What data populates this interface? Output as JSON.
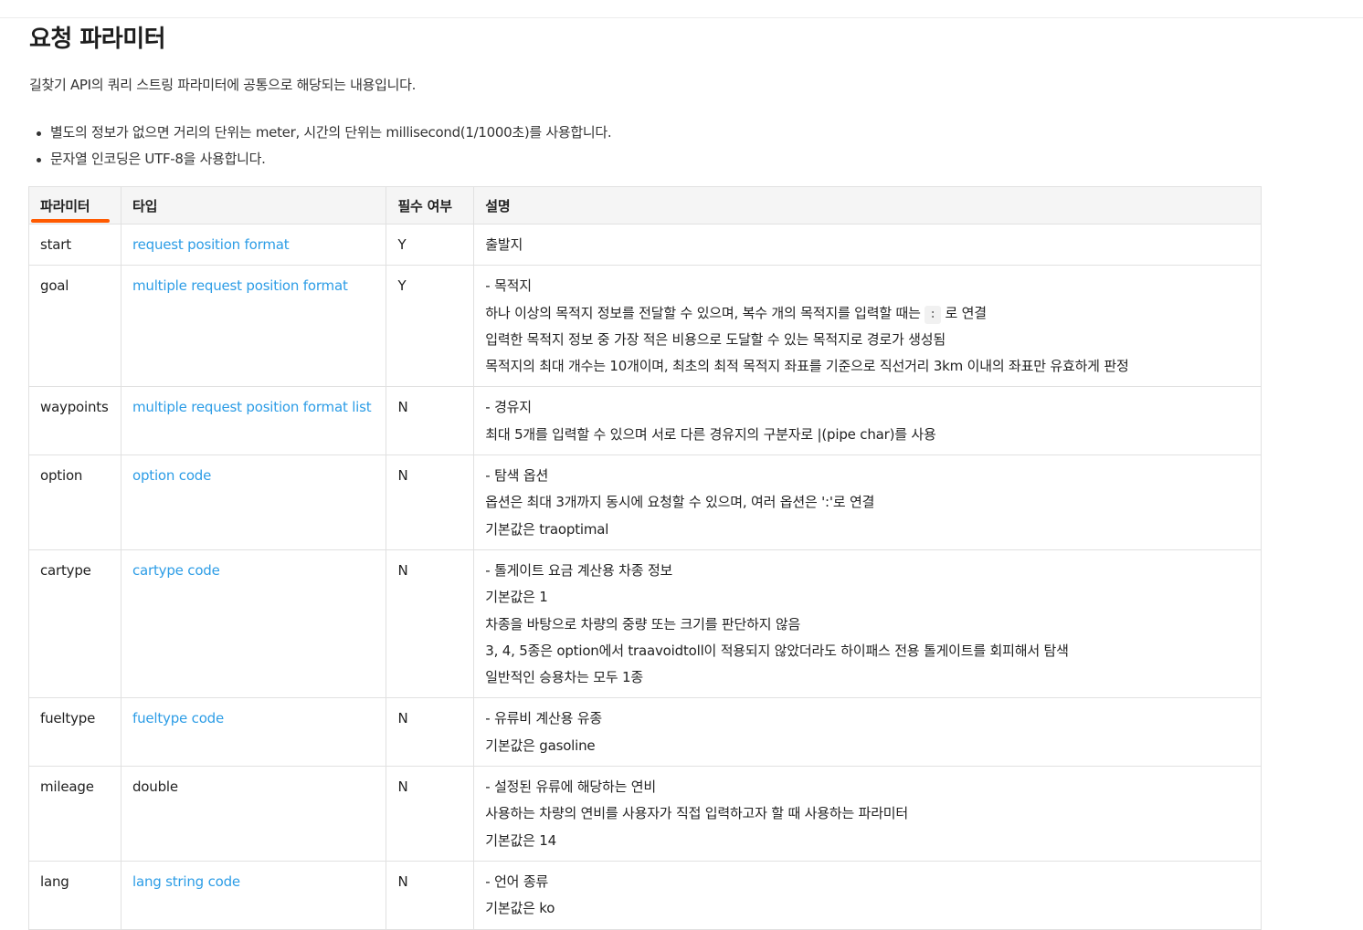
{
  "page": {
    "title": "요청 파라미터",
    "intro": "길찾기 API의 쿼리 스트링 파라미터에 공통으로 해당되는 내용입니다.",
    "bullets": [
      "별도의 정보가 없으면 거리의 단위는 meter, 시간의 단위는 millisecond(1/1000초)를 사용합니다.",
      "문자열 인코딩은 UTF-8을 사용합니다."
    ]
  },
  "table": {
    "headers": {
      "param": "파라미터",
      "type": "타입",
      "required": "필수 여부",
      "desc": "설명"
    },
    "accent_color": "#ff5a00",
    "link_color": "#2d9de6",
    "rows": [
      {
        "param": "start",
        "type": "request position format",
        "link": true,
        "required": "Y",
        "desc": [
          "출발지"
        ]
      },
      {
        "param": "goal",
        "type": "multiple request position format",
        "link": true,
        "required": "Y",
        "desc": [
          "- 목적지",
          "하나 이상의 목적지 정보를 전달할 수 있으며, 복수 개의 목적지를 입력할 때는",
          "입력한 목적지 정보 중 가장 적은 비용으로 도달할 수 있는 목적지로 경로가 생성됨",
          "목적지의 최대 개수는 10개이며, 최초의 최적 목적지 좌표를 기준으로 직선거리 3km 이내의 좌표만 유효하게 판정"
        ],
        "code": ":",
        "code_suffix": " 로 연결"
      },
      {
        "param": "waypoints",
        "type": "multiple request position format list",
        "link": true,
        "required": "N",
        "desc": [
          "- 경유지",
          "최대 5개를 입력할 수 있으며 서로 다른 경유지의 구분자로 |(pipe char)를 사용"
        ]
      },
      {
        "param": "option",
        "type": "option code",
        "link": true,
        "required": "N",
        "desc": [
          "- 탐색 옵션",
          "옵션은 최대 3개까지 동시에 요청할 수 있으며, 여러 옵션은 ':'로 연결",
          "기본값은 traoptimal"
        ]
      },
      {
        "param": "cartype",
        "type": "cartype code",
        "link": true,
        "required": "N",
        "desc": [
          "- 톨게이트 요금 계산용 차종 정보",
          "기본값은 1",
          "차종을 바탕으로 차량의 중량 또는 크기를 판단하지 않음",
          "3, 4, 5종은 option에서 traavoidtoll이 적용되지 않았더라도 하이패스 전용 톨게이트를 회피해서 탐색",
          "일반적인 승용차는 모두 1종"
        ]
      },
      {
        "param": "fueltype",
        "type": "fueltype code",
        "link": true,
        "required": "N",
        "desc": [
          "- 유류비 계산용 유종",
          "기본값은 gasoline"
        ]
      },
      {
        "param": "mileage",
        "type": "double",
        "link": false,
        "required": "N",
        "desc": [
          "- 설정된 유류에 해당하는 연비",
          "사용하는 차량의 연비를 사용자가 직접 입력하고자 할 때 사용하는 파라미터",
          "기본값은 14"
        ]
      },
      {
        "param": "lang",
        "type": "lang string code",
        "link": true,
        "required": "N",
        "desc": [
          "- 언어 종류",
          "기본값은 ko"
        ]
      }
    ]
  }
}
